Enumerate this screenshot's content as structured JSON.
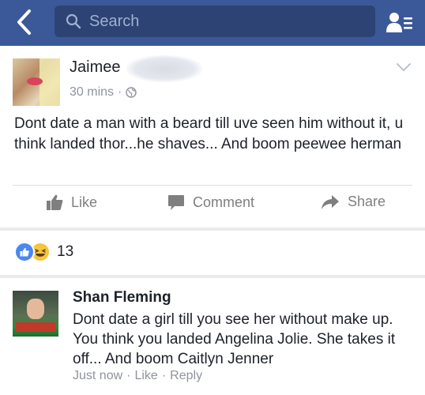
{
  "header": {
    "search_placeholder": "Search"
  },
  "post": {
    "author_first_name": "Jaimee",
    "timestamp": "30 mins",
    "separator": "·",
    "privacy_icon": "globe-icon",
    "text": "Dont date a man with a beard till uve seen him without it, u think landed thor...he shaves... And boom peewee herman",
    "actions": {
      "like_label": "Like",
      "comment_label": "Comment",
      "share_label": "Share"
    }
  },
  "reactions": {
    "types": [
      "like",
      "haha"
    ],
    "count": "13"
  },
  "comment": {
    "author": "Shan Fleming",
    "text": "Dont date a girl till you see her without make up. You think you landed Angelina Jolie. She takes it off... And boom Caitlyn Jenner",
    "time": "Just now",
    "sep1": "·",
    "like_label": "Like",
    "sep2": "·",
    "reply_label": "Reply"
  },
  "colors": {
    "topbar": "#3b5998",
    "search_bg": "#2d4373",
    "muted_text": "#90949c",
    "like_blue": "#4c87ef",
    "haha_yellow": "#f7c53c"
  }
}
